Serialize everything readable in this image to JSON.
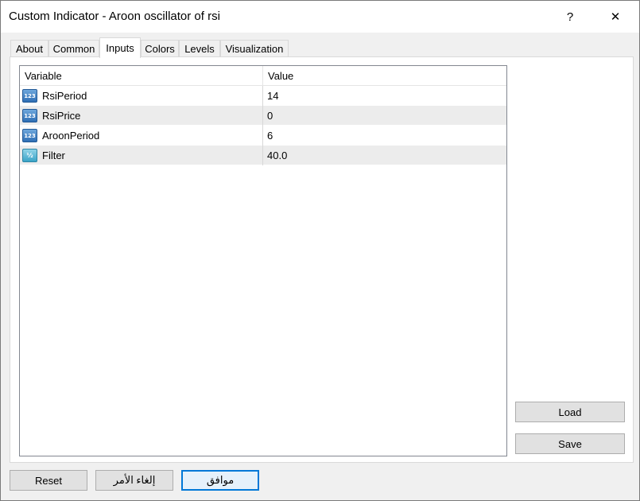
{
  "window": {
    "title": "Custom Indicator - Aroon oscillator of rsi",
    "help_label": "?",
    "close_label": "✕"
  },
  "tabs": [
    {
      "label": "About"
    },
    {
      "label": "Common"
    },
    {
      "label": "Inputs"
    },
    {
      "label": "Colors"
    },
    {
      "label": "Levels"
    },
    {
      "label": "Visualization"
    }
  ],
  "active_tab": "Inputs",
  "grid": {
    "columns": [
      "Variable",
      "Value"
    ],
    "rows": [
      {
        "icon": "integer-icon",
        "icon_text": "123",
        "variable": "RsiPeriod",
        "value": "14"
      },
      {
        "icon": "integer-icon",
        "icon_text": "123",
        "variable": "RsiPrice",
        "value": "0"
      },
      {
        "icon": "integer-icon",
        "icon_text": "123",
        "variable": "AroonPeriod",
        "value": "6"
      },
      {
        "icon": "double-icon",
        "icon_text": "½",
        "variable": "Filter",
        "value": "40.0"
      }
    ]
  },
  "buttons": {
    "load": "Load",
    "save": "Save",
    "reset": "Reset",
    "cancel": "إلغاء الأمر",
    "ok": "موافق"
  }
}
